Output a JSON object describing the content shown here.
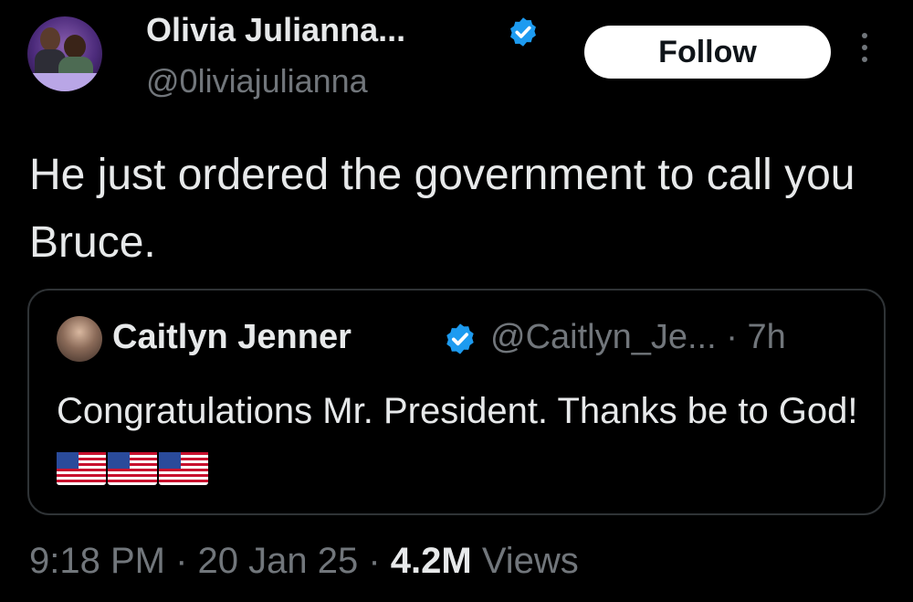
{
  "author": {
    "display_name": "Olivia Julianna...",
    "handle": "@0liviajulianna",
    "verified_icon": "verified-badge-icon"
  },
  "follow_button": {
    "label": "Follow"
  },
  "more_menu": {
    "icon": "more-vertical-icon"
  },
  "tweet": {
    "text": "He just ordered the government to call you Bruce."
  },
  "quoted_tweet": {
    "display_name": "Caitlyn Jenner",
    "handle_time": "@Caitlyn_Je... · 7h",
    "text": "Congratulations Mr. President. Thanks be to God!",
    "emojis": [
      "us-flag-icon",
      "us-flag-icon",
      "us-flag-icon"
    ]
  },
  "footer": {
    "timestamp": "9:18 PM · 20 Jan 25 · ",
    "views_count": "4.2M",
    "views_label": "Views"
  },
  "colors": {
    "background": "#000000",
    "text_primary": "#e7e9ea",
    "text_secondary": "#71767b",
    "verified_blue": "#1d9bf0",
    "border": "#2f3336",
    "follow_bg": "#ffffff"
  }
}
